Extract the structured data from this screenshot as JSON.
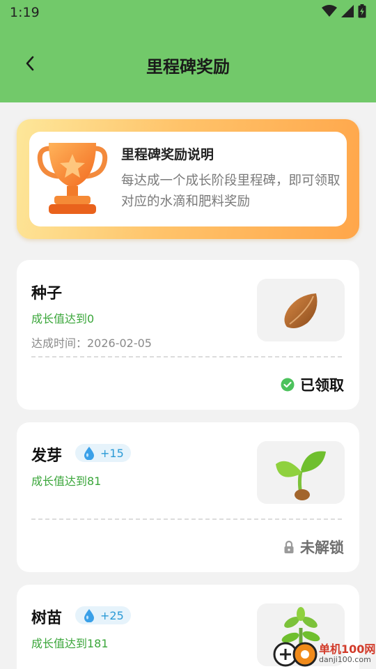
{
  "status_bar": {
    "time": "1:19"
  },
  "header": {
    "title": "里程碑奖励"
  },
  "banner": {
    "title": "里程碑奖励说明",
    "description": "每达成一个成长阶段里程碑，即可领取对应的水滴和肥料奖励"
  },
  "milestones": [
    {
      "name": "种子",
      "requirement": "成长值达到0",
      "time_label": "达成时间：2026-02-05",
      "status": "已领取",
      "icon": "seed-icon"
    },
    {
      "name": "发芽",
      "reward": "+15",
      "requirement": "成长值达到81",
      "status": "未解锁",
      "icon": "sprout-icon"
    },
    {
      "name": "树苗",
      "reward": "+25",
      "requirement": "成长值达到181",
      "icon": "sapling-icon"
    }
  ],
  "watermark": {
    "text": "单机100网",
    "sub": "danji100.com"
  },
  "colors": {
    "header_bg": "#72c96a",
    "requirement_text": "#3aa63a",
    "claimed_check": "#4cc25c",
    "reward_pill_bg": "#e6f3fb",
    "reward_pill_text": "#2b9ad6"
  }
}
